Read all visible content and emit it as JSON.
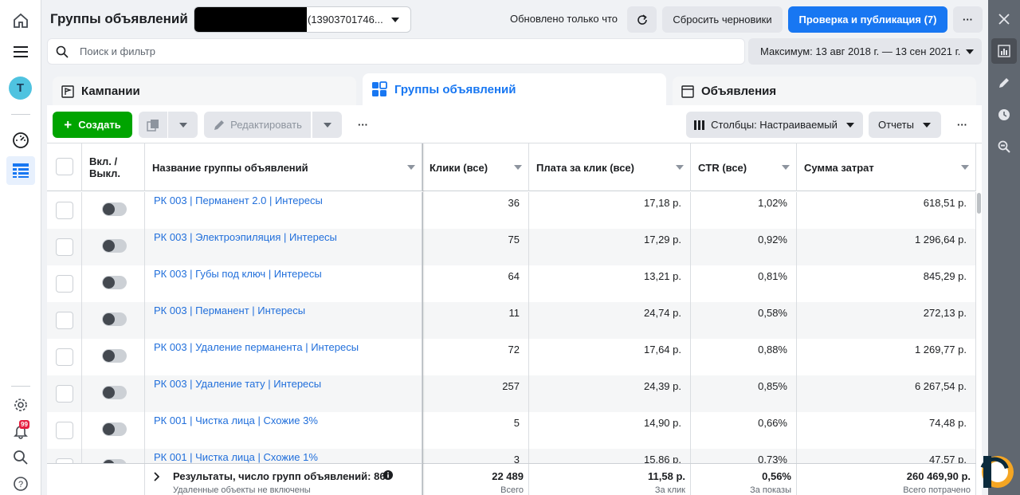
{
  "header": {
    "title": "Группы объявлений",
    "account_id": "(13903701746...",
    "updated": "Обновлено только что",
    "discard_drafts": "Сбросить черновики",
    "publish": "Проверка и публикация (7)",
    "more": "···"
  },
  "search": {
    "placeholder": "Поиск и фильтр"
  },
  "date_range": {
    "label": "Максимум: 13 авг 2018 г. — 13 сен 2021 г."
  },
  "tabs": [
    {
      "label": "Кампании"
    },
    {
      "label": "Группы объявлений"
    },
    {
      "label": "Объявления"
    }
  ],
  "toolbar": {
    "create": "Создать",
    "edit": "Редактировать",
    "more": "···",
    "columns": "Столбцы: Настраиваемый",
    "reports": "Отчеты",
    "more_right": "···"
  },
  "table": {
    "columns": {
      "toggle": "Вкл. / Выкл.",
      "name": "Название группы объявлений",
      "clicks": "Клики (все)",
      "cpc": "Плата за клик (все)",
      "ctr": "CTR (все)",
      "spend": "Сумма затрат"
    },
    "rows": [
      {
        "name": "РК 003 | Перманент 2.0 | Интересы",
        "clicks": "36",
        "cpc": "17,18 р.",
        "ctr": "1,02%",
        "spend": "618,51 р."
      },
      {
        "name": "РК 003 | Электроэпиляция | Интересы",
        "clicks": "75",
        "cpc": "17,29 р.",
        "ctr": "0,92%",
        "spend": "1 296,64 р."
      },
      {
        "name": "РК 003 | Губы под ключ | Интересы",
        "clicks": "64",
        "cpc": "13,21 р.",
        "ctr": "0,81%",
        "spend": "845,29 р."
      },
      {
        "name": "РК 003 | Перманент | Интересы",
        "clicks": "11",
        "cpc": "24,74 р.",
        "ctr": "0,58%",
        "spend": "272,13 р."
      },
      {
        "name": "РК 003 | Удаление перманента | Интересы",
        "clicks": "72",
        "cpc": "17,64 р.",
        "ctr": "0,88%",
        "spend": "1 269,77 р."
      },
      {
        "name": "РК 003 | Удаление тату | Интересы",
        "clicks": "257",
        "cpc": "24,39 р.",
        "ctr": "0,85%",
        "spend": "6 267,54 р."
      },
      {
        "name": "РК 001 | Чистка лица | Схожие 3%",
        "clicks": "5",
        "cpc": "14,90 р.",
        "ctr": "0,66%",
        "spend": "74,48 р."
      },
      {
        "name": "РК 001 | Чистка лица | Схожие 1%",
        "clicks": "3",
        "cpc": "15,86 р.",
        "ctr": "0,73%",
        "spend": "47,57 р."
      }
    ],
    "totals": {
      "label": "Результаты, число групп объявлений: 86",
      "sublabel": "Удаленные объекты не включены",
      "clicks": "22 489",
      "clicks_sub": "Всего",
      "cpc": "11,58 р.",
      "cpc_sub": "За клик",
      "ctr": "0,56%",
      "ctr_sub": "За показы",
      "spend": "260 469,90 р.",
      "spend_sub": "Всего потрачено"
    }
  },
  "nav": {
    "avatar_letter": "T",
    "notifications_count": "99"
  },
  "colors": {
    "accent": "#1877f2",
    "create": "#00a400",
    "link": "#216fdb"
  }
}
